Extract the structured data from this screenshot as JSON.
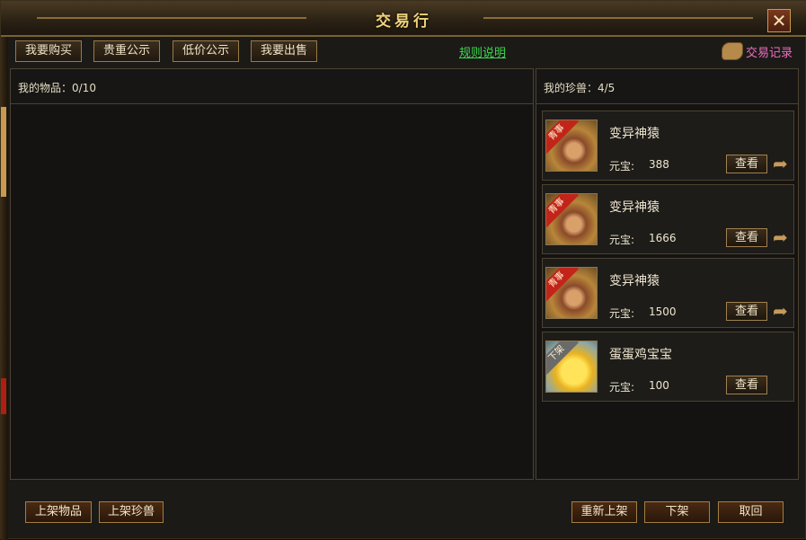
{
  "window": {
    "title": "交易行"
  },
  "tabs": [
    {
      "label": "我要购买"
    },
    {
      "label": "贵重公示"
    },
    {
      "label": "低价公示"
    },
    {
      "label": "我要出售"
    }
  ],
  "rules_link": "规则说明",
  "trade_record": {
    "label": "交易记录",
    "icon": "scroll-icon"
  },
  "close_icon": "✕",
  "my_items": {
    "label": "我的物品：0/10"
  },
  "my_pets": {
    "label": "我的珍兽：4/5",
    "items": [
      {
        "name": "变异神猿",
        "price_label": "元宝:",
        "price": "388",
        "ribbon": "青事",
        "view_label": "查看",
        "arrow": "➦"
      },
      {
        "name": "变异神猿",
        "price_label": "元宝:",
        "price": "1666",
        "ribbon": "青事",
        "view_label": "查看",
        "arrow": "➦"
      },
      {
        "name": "变异神猿",
        "price_label": "元宝:",
        "price": "1500",
        "ribbon": "青事",
        "view_label": "查看",
        "arrow": "➦"
      },
      {
        "name": "蛋蛋鸡宝宝",
        "price_label": "元宝:",
        "price": "100",
        "ribbon": "下架",
        "view_label": "查看"
      }
    ]
  },
  "buttons": {
    "list_item": "上架物品",
    "list_pet": "上架珍兽",
    "relist": "重新上架",
    "delist": "下架",
    "retrieve": "取回"
  },
  "colors": {
    "accent_gold": "#f0d27a",
    "link_green": "#3cd84e",
    "record_pink": "#ee6ec0",
    "ribbon_red": "#c2241a"
  }
}
